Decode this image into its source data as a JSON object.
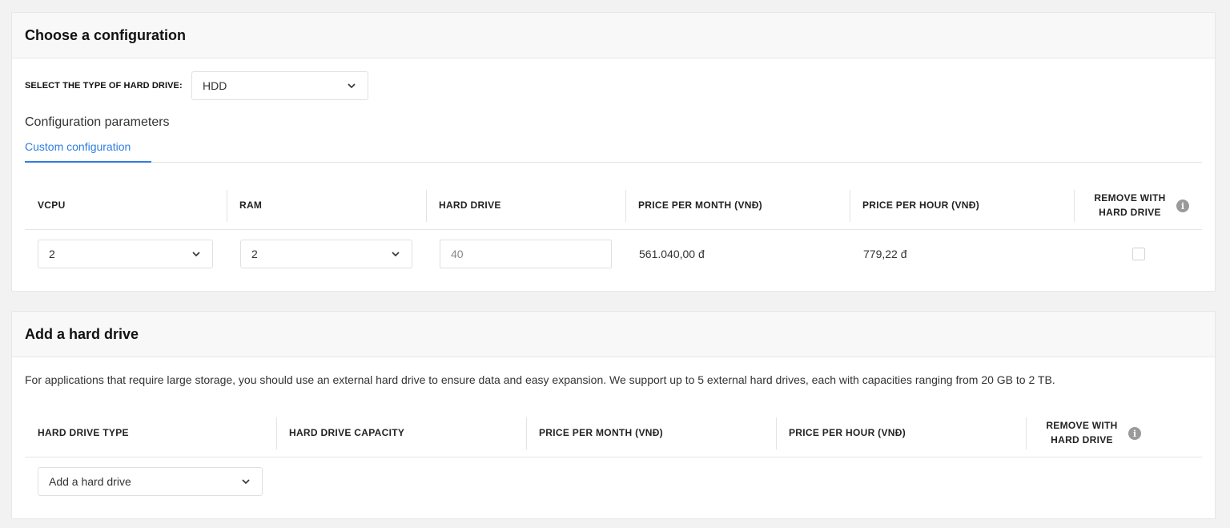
{
  "config": {
    "title": "Choose a configuration",
    "drive_type_label": "SELECT THE TYPE OF HARD DRIVE:",
    "drive_type_value": "HDD",
    "params_title": "Configuration parameters",
    "tab_custom": "Custom configuration",
    "table": {
      "headers": {
        "vcpu": "VCPU",
        "ram": "RAM",
        "hard_drive": "HARD DRIVE",
        "price_month": "PRICE PER MONTH (VNĐ)",
        "price_hour": "PRICE PER HOUR (VNĐ)",
        "remove_line1": "REMOVE WITH",
        "remove_line2": "HARD DRIVE"
      },
      "row": {
        "vcpu": "2",
        "ram": "2",
        "hard_drive_placeholder": "40",
        "price_month": "561.040,00 đ",
        "price_hour": "779,22 đ",
        "remove_checked": false
      }
    }
  },
  "add_drive": {
    "title": "Add a hard drive",
    "description": "For applications that require large storage, you should use an external hard drive to ensure data and easy expansion. We support up to 5 external hard drives, each with capacities ranging from 20 GB to 2 TB.",
    "table": {
      "headers": {
        "type": "HARD DRIVE TYPE",
        "capacity": "HARD DRIVE CAPACITY",
        "price_month": "PRICE PER MONTH (VNĐ)",
        "price_hour": "PRICE PER HOUR (VNĐ)",
        "remove_line1": "REMOVE WITH",
        "remove_line2": "HARD DRIVE"
      },
      "add_select_value": "Add a hard drive"
    }
  },
  "icons": {
    "info": "i",
    "chevron": "chevron-down-icon"
  },
  "colors": {
    "accent": "#2f7de1",
    "background": "#f2f2f2"
  }
}
